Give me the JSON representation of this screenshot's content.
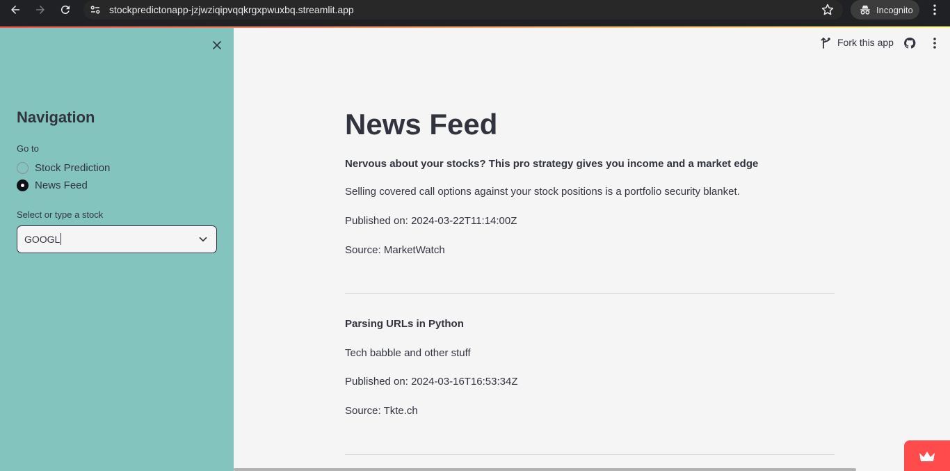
{
  "browser": {
    "url": "stockpredictonapp-jzjwziqipvqqkrgxpwuxbq.streamlit.app",
    "incognito_label": "Incognito"
  },
  "colors": {
    "sidebar_bg": "#83c5be",
    "main_bg": "#f5f5f5",
    "text": "#31333f",
    "accent": "#ff4b4b"
  },
  "sidebar": {
    "heading": "Navigation",
    "goto_label": "Go to",
    "options": [
      {
        "label": "Stock Prediction",
        "selected": false
      },
      {
        "label": "News Feed",
        "selected": true
      }
    ],
    "select_label": "Select or type a stock",
    "select_value": "GOOGL"
  },
  "toolbar": {
    "fork_label": "Fork this app"
  },
  "main": {
    "title": "News Feed",
    "articles": [
      {
        "title": "Nervous about your stocks? This pro strategy gives you income and a market edge",
        "description": "Selling covered call options against your stock positions is a portfolio security blanket.",
        "published": "Published on: 2024-03-22T11:14:00Z",
        "source": "Source: MarketWatch"
      },
      {
        "title": "Parsing URLs in Python",
        "description": "Tech babble and other stuff",
        "published": "Published on: 2024-03-16T16:53:34Z",
        "source": "Source: Tkte.ch"
      }
    ]
  }
}
